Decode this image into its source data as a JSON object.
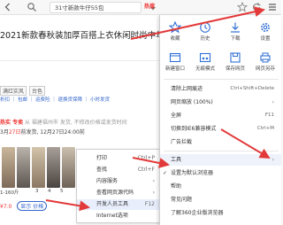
{
  "toolbar": {
    "address_text": "31寸新款牛仔55包",
    "address_brand": "热搜",
    "icons": [
      "back-icon",
      "search-icon",
      "dropdown-icon",
      "star-icon",
      "menu-icon"
    ]
  },
  "page": {
    "title": "2021新款春秋装加厚百搭上衣休闲时尚中年女士卡",
    "filters": [
      "满红实风",
      "台色"
    ],
    "tabs": "折扣  ｜  包邮  ｜  运费险  ｜  退换货保障  ｜  小时发货",
    "shipping_hot": "热实  专卖",
    "shipping_text": "从 福建福州市 发货, 不修改价格或发货时间",
    "dates_prefix": "3月",
    "dates_highlight": "27日",
    "dates_text": "前发货, 12月27日24:00前",
    "sizes": [
      "3",
      "4",
      "5"
    ],
    "size_prefix": "1-160斤",
    "bottom_price": "¥7.0",
    "bottom_pill": "显示 价格"
  },
  "menu": {
    "tiles": [
      {
        "label": "收藏",
        "icon": "star-icon"
      },
      {
        "label": "历史",
        "icon": "history-icon"
      },
      {
        "label": "下载",
        "icon": "download-icon"
      },
      {
        "label": "设置",
        "icon": "gear-icon"
      },
      {
        "label": "新建窗口",
        "icon": "new-window-icon"
      },
      {
        "label": "无痕模式",
        "icon": "incognito-icon"
      },
      {
        "label": "保存网页",
        "icon": "save-page-icon"
      },
      {
        "label": "网页另存",
        "icon": "print-icon"
      }
    ],
    "items": [
      {
        "label": "清除上网痕迹",
        "shortcut": "Ctrl+Shift+Delete"
      },
      {
        "label": "网页缩放 (100%)",
        "shortcut": "›"
      },
      {
        "label": "全屏",
        "shortcut": "F11"
      },
      {
        "label": "切换到IE6兼容模式",
        "shortcut": "Ctrl+M"
      },
      {
        "label": "广告拦截",
        "shortcut": ""
      },
      {
        "label": "工具",
        "shortcut": "›"
      },
      {
        "label": "设置为默认浏览器",
        "shortcut": ""
      },
      {
        "label": "帮助",
        "shortcut": ""
      },
      {
        "label": "常见问题",
        "shortcut": ""
      },
      {
        "label": "了解360企业版浏览器",
        "shortcut": ""
      }
    ]
  },
  "submenu": {
    "items": [
      {
        "label": "打印",
        "shortcut": "Ctrl+P"
      },
      {
        "label": "查找",
        "shortcut": "Ctrl+F"
      },
      {
        "label": "内容服务",
        "shortcut": "›"
      },
      {
        "label": "查看网页源代码",
        "shortcut": "›"
      },
      {
        "label": "开发人员工具",
        "shortcut": "F12"
      },
      {
        "label": "Internet选项",
        "shortcut": ""
      }
    ]
  },
  "colors": {
    "accent_blue": "#2f6fd6",
    "arrow_red": "#e23a3a",
    "menu_highlight": "#eef2fb"
  }
}
